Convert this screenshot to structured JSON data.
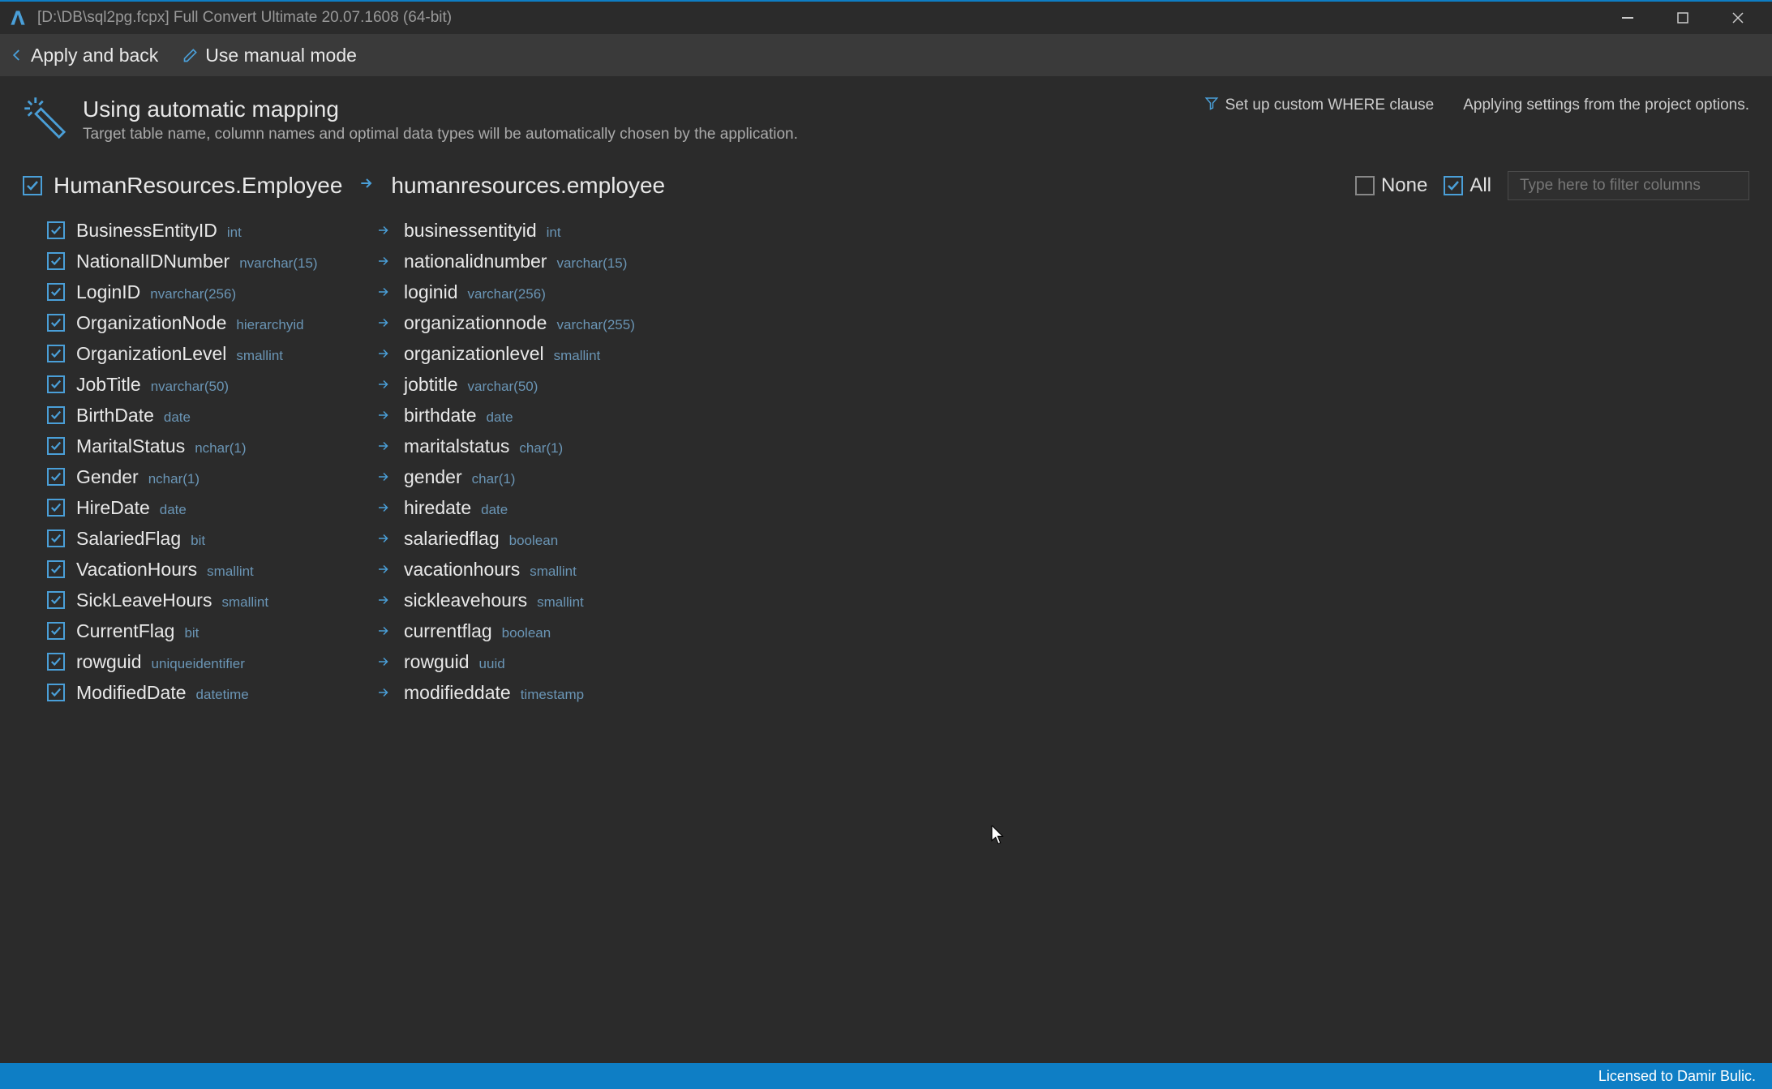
{
  "window": {
    "title": "[D:\\DB\\sql2pg.fcpx] Full Convert Ultimate 20.07.1608 (64-bit)"
  },
  "toolbar": {
    "apply_back": "Apply and back",
    "manual_mode": "Use manual mode"
  },
  "header": {
    "title": "Using automatic mapping",
    "subtitle": "Target table name, column names and optimal data types will be automatically chosen by the application.",
    "where_clause": "Set up custom WHERE clause",
    "status_msg": "Applying settings from the project options."
  },
  "table": {
    "source": "HumanResources.Employee",
    "target": "humanresources.employee"
  },
  "filters": {
    "none_label": "None",
    "all_label": "All",
    "filter_placeholder": "Type here to filter columns"
  },
  "columns": [
    {
      "src_name": "BusinessEntityID",
      "src_type": "int",
      "tgt_name": "businessentityid",
      "tgt_type": "int"
    },
    {
      "src_name": "NationalIDNumber",
      "src_type": "nvarchar(15)",
      "tgt_name": "nationalidnumber",
      "tgt_type": "varchar(15)"
    },
    {
      "src_name": "LoginID",
      "src_type": "nvarchar(256)",
      "tgt_name": "loginid",
      "tgt_type": "varchar(256)"
    },
    {
      "src_name": "OrganizationNode",
      "src_type": "hierarchyid",
      "tgt_name": "organizationnode",
      "tgt_type": "varchar(255)"
    },
    {
      "src_name": "OrganizationLevel",
      "src_type": "smallint",
      "tgt_name": "organizationlevel",
      "tgt_type": "smallint"
    },
    {
      "src_name": "JobTitle",
      "src_type": "nvarchar(50)",
      "tgt_name": "jobtitle",
      "tgt_type": "varchar(50)"
    },
    {
      "src_name": "BirthDate",
      "src_type": "date",
      "tgt_name": "birthdate",
      "tgt_type": "date"
    },
    {
      "src_name": "MaritalStatus",
      "src_type": "nchar(1)",
      "tgt_name": "maritalstatus",
      "tgt_type": "char(1)"
    },
    {
      "src_name": "Gender",
      "src_type": "nchar(1)",
      "tgt_name": "gender",
      "tgt_type": "char(1)"
    },
    {
      "src_name": "HireDate",
      "src_type": "date",
      "tgt_name": "hiredate",
      "tgt_type": "date"
    },
    {
      "src_name": "SalariedFlag",
      "src_type": "bit",
      "tgt_name": "salariedflag",
      "tgt_type": "boolean"
    },
    {
      "src_name": "VacationHours",
      "src_type": "smallint",
      "tgt_name": "vacationhours",
      "tgt_type": "smallint"
    },
    {
      "src_name": "SickLeaveHours",
      "src_type": "smallint",
      "tgt_name": "sickleavehours",
      "tgt_type": "smallint"
    },
    {
      "src_name": "CurrentFlag",
      "src_type": "bit",
      "tgt_name": "currentflag",
      "tgt_type": "boolean"
    },
    {
      "src_name": "rowguid",
      "src_type": "uniqueidentifier",
      "tgt_name": "rowguid",
      "tgt_type": "uuid"
    },
    {
      "src_name": "ModifiedDate",
      "src_type": "datetime",
      "tgt_name": "modifieddate",
      "tgt_type": "timestamp"
    }
  ],
  "statusbar": {
    "license": "Licensed to Damir Bulic."
  }
}
